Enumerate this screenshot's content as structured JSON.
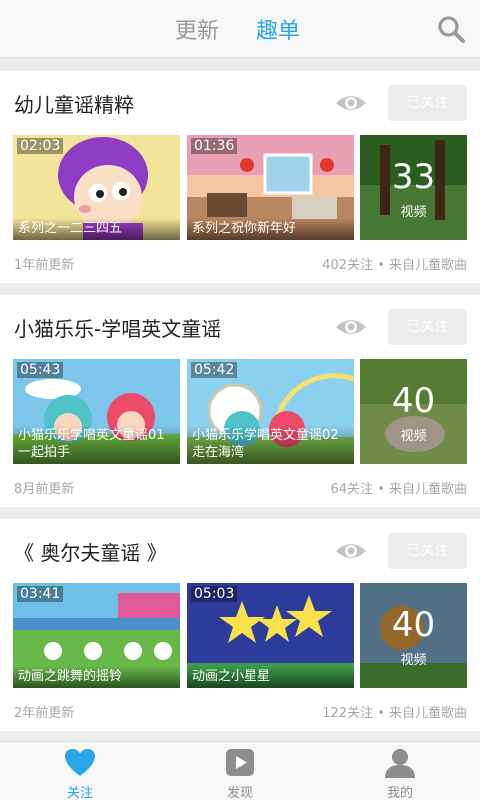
{
  "header": {
    "tab_update": "更新",
    "tab_fun": "趣单"
  },
  "cards": [
    {
      "title": "幼儿童谣精粹",
      "follow_label": "已关注",
      "videos": [
        {
          "duration": "02:03",
          "caption": "系列之一二三四五"
        },
        {
          "duration": "01:36",
          "caption": "系列之祝你新年好"
        }
      ],
      "count": "33",
      "count_unit": "视频",
      "updated": "1年前更新",
      "meta": "402关注 • 来自儿童歌曲"
    },
    {
      "title": "小猫乐乐-学唱英文童谣",
      "follow_label": "已关注",
      "videos": [
        {
          "duration": "05:43",
          "caption": "小猫乐乐学唱英文童谣01一起拍手"
        },
        {
          "duration": "05:42",
          "caption": "小猫乐乐学唱英文童谣02走在海湾"
        }
      ],
      "count": "40",
      "count_unit": "视频",
      "updated": "8月前更新",
      "meta": "64关注 • 来自儿童歌曲"
    },
    {
      "title": "《 奥尔夫童谣 》",
      "follow_label": "已关注",
      "videos": [
        {
          "duration": "03:41",
          "caption": "动画之跳舞的摇铃"
        },
        {
          "duration": "05:03",
          "caption": "动画之小星星"
        }
      ],
      "count": "40",
      "count_unit": "视频",
      "updated": "2年前更新",
      "meta": "122关注 • 来自儿童歌曲"
    }
  ],
  "bottom_nav": {
    "follow": "关注",
    "discover": "发现",
    "mine": "我的"
  },
  "colors": {
    "accent": "#2aa6e8",
    "muted": "#a7a7a7"
  }
}
